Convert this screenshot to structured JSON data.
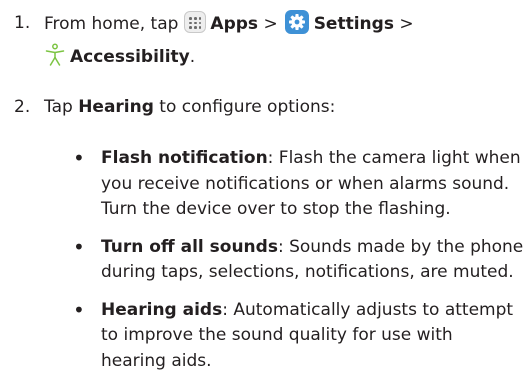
{
  "steps": [
    {
      "number": "1.",
      "line1": {
        "prefix": "From home, tap",
        "apps": "Apps",
        "sep1": ">",
        "settings": "Settings",
        "sep2": ">"
      },
      "line2": {
        "accessibility": "Accessibility",
        "end": "."
      }
    },
    {
      "number": "2.",
      "text": {
        "prefix": "Tap ",
        "hearing": "Hearing",
        "suffix": " to configure options:"
      }
    }
  ],
  "bullets": [
    {
      "glyph": "•",
      "title": "Flash notification",
      "line1_rest": ": Flash the camera light when",
      "line2": "you receive notifications or when alarms sound.",
      "line3": "Turn the device over to stop the flashing."
    },
    {
      "glyph": "•",
      "title": "Turn off all sounds",
      "line1_rest": ": Sounds made by the phone",
      "line2": "during taps, selections, notifications, are muted."
    },
    {
      "glyph": "•",
      "title": "Hearing aids",
      "line1_rest": ": Automatically adjusts to attempt",
      "line2": "to improve the sound quality for use with",
      "line3": "hearing aids."
    }
  ],
  "icons": {
    "apps": "apps-icon",
    "settings": "settings-icon",
    "accessibility": "accessibility-icon"
  },
  "colors": {
    "text": "#231f20",
    "settings_blue": "#3e91d6",
    "accessibility_green": "#7cc443"
  }
}
